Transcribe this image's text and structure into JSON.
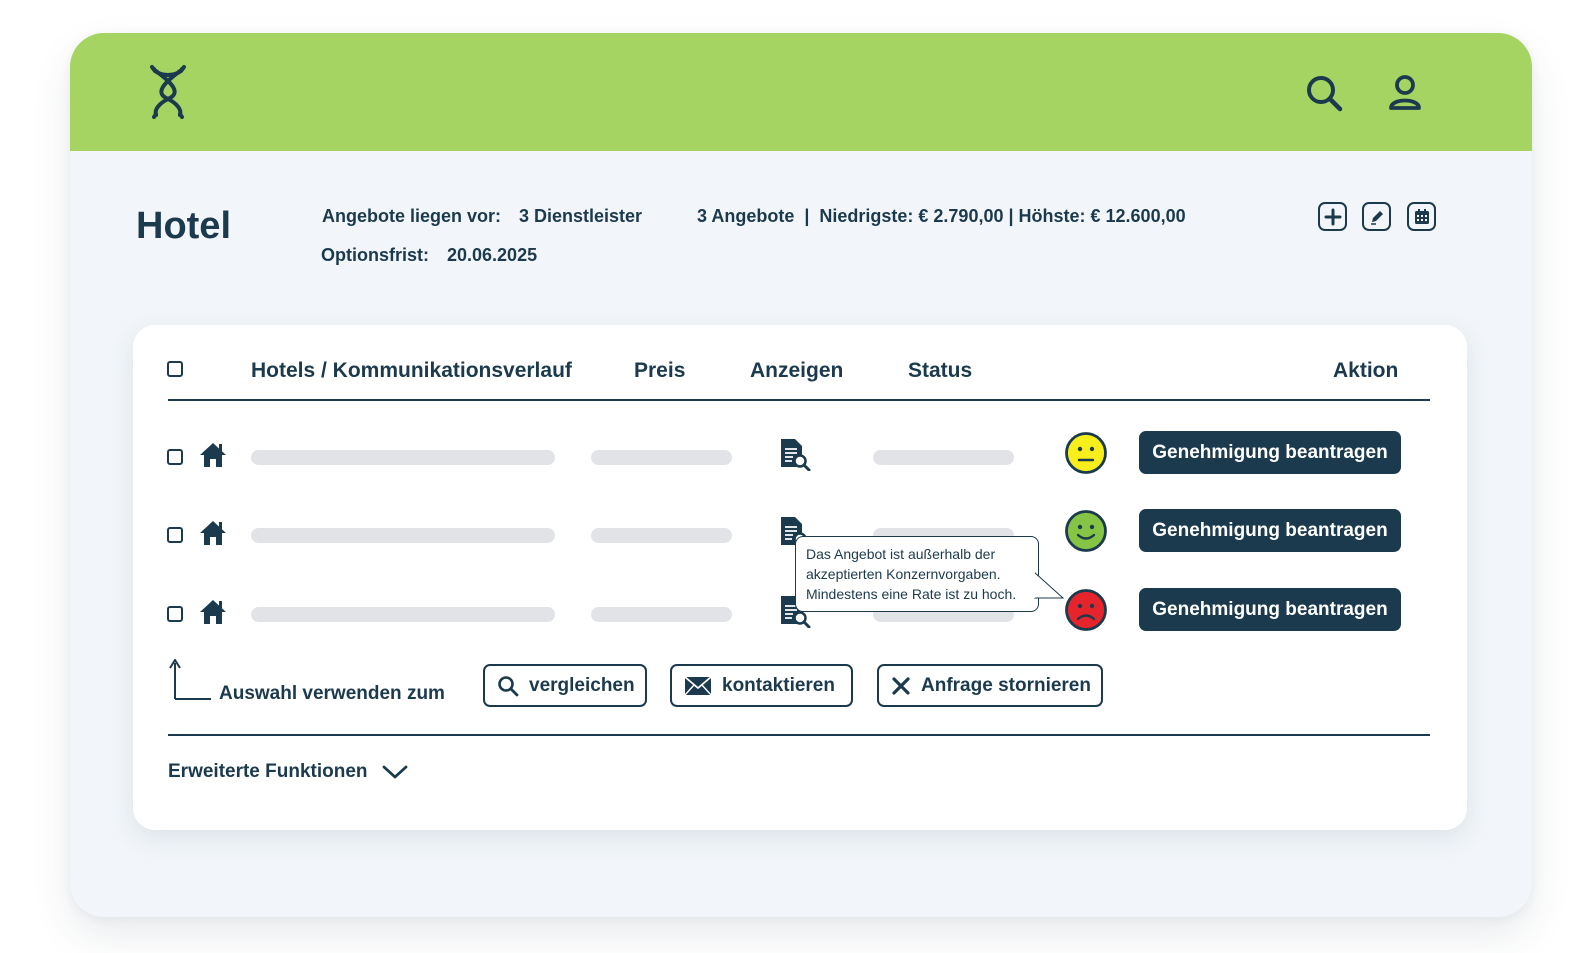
{
  "header": {
    "logo": "pretzel-logo-icon",
    "icons": [
      "search-icon",
      "user-icon"
    ],
    "accent_color": "#a5d463"
  },
  "page": {
    "title": "Hotel",
    "offers_label": "Angebote liegen vor:",
    "offers_value": "3 Dienstleister",
    "offers_summary": "3 Angebote  |  Niedrigste: € 2.790,00 | Höhste: € 12.600,00",
    "option_label": "Optionsfrist:",
    "option_value": "20.06.2025",
    "tools": [
      "plus-icon",
      "edit-icon",
      "calendar-icon"
    ]
  },
  "table": {
    "headers": {
      "hotels": "Hotels / Kommunikationsverlauf",
      "price": "Preis",
      "show": "Anzeigen",
      "status": "Status",
      "action": "Aktion"
    },
    "rows": [
      {
        "status_icon": "neutral-face-icon",
        "status_color": "#f7ee1b",
        "action_label": "Genehmigung beantragen"
      },
      {
        "status_icon": "happy-face-icon",
        "status_color": "#86c446",
        "action_label": "Genehmigung beantragen"
      },
      {
        "status_icon": "sad-face-icon",
        "status_color": "#e5242b",
        "action_label": "Genehmigung beantragen"
      }
    ]
  },
  "tooltip": {
    "line1": "Das Angebot ist außerhalb der",
    "line2": "akzeptierten Konzernvorgaben.",
    "line3": "Mindestens eine Rate ist zu hoch."
  },
  "selection": {
    "label": "Auswahl verwenden zum",
    "compare": "vergleichen",
    "contact": "kontaktieren",
    "cancel": "Anfrage stornieren"
  },
  "advanced": {
    "label": "Erweiterte Funktionen"
  }
}
